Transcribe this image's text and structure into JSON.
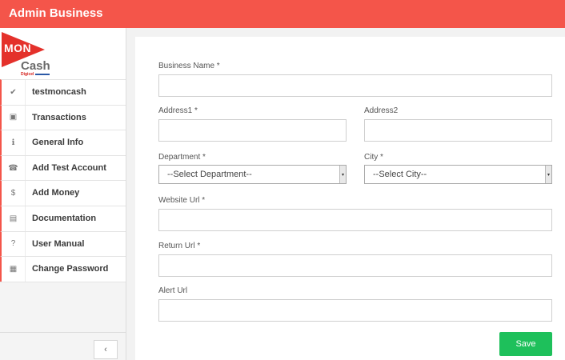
{
  "header": {
    "title": "Admin Business"
  },
  "logo": {
    "mon": "MON",
    "cash": "Cash",
    "brand": "Digicel"
  },
  "sidebar": {
    "items": [
      {
        "icon": "check-icon",
        "glyph": "✔",
        "label": "testmoncash"
      },
      {
        "icon": "money-icon",
        "glyph": "▣",
        "label": "Transactions"
      },
      {
        "icon": "info-icon",
        "glyph": "ℹ",
        "label": "General Info"
      },
      {
        "icon": "phone-icon",
        "glyph": "☎",
        "label": "Add Test Account"
      },
      {
        "icon": "dollar-icon",
        "glyph": "$",
        "label": "Add Money"
      },
      {
        "icon": "book-icon",
        "glyph": "▤",
        "label": "Documentation"
      },
      {
        "icon": "question-icon",
        "glyph": "?",
        "label": "User Manual"
      },
      {
        "icon": "briefcase-icon",
        "glyph": "▦",
        "label": "Change Password"
      }
    ],
    "collapse_glyph": "‹"
  },
  "form": {
    "business_name": {
      "label": "Business Name *",
      "value": ""
    },
    "address1": {
      "label": "Address1 *",
      "value": ""
    },
    "address2": {
      "label": "Address2",
      "value": ""
    },
    "department": {
      "label": "Department *",
      "selected": "--Select Department--"
    },
    "city": {
      "label": "City *",
      "selected": "--Select City--"
    },
    "website_url": {
      "label": "Website Url *",
      "value": ""
    },
    "return_url": {
      "label": "Return Url *",
      "value": ""
    },
    "alert_url": {
      "label": "Alert Url",
      "value": ""
    },
    "select_arrow": "▾",
    "save_label": "Save"
  }
}
